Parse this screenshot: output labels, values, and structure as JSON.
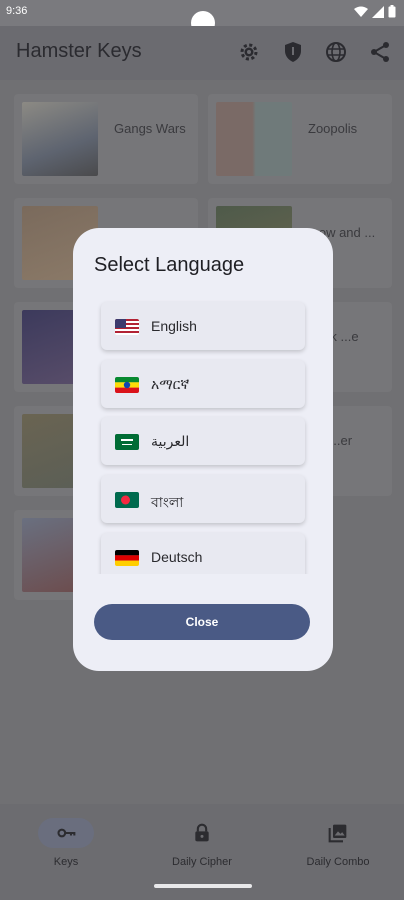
{
  "status": {
    "time": "9:36"
  },
  "app_bar": {
    "title": "Hamster Keys",
    "actions": [
      "gear-icon",
      "shield-icon",
      "globe-icon",
      "share-icon"
    ]
  },
  "games": [
    {
      "title": "Gangs Wars"
    },
    {
      "title": "Zoopolis"
    },
    {
      "title": "...ow and ..."
    },
    {
      "title": "...erk ...e"
    },
    {
      "title": "...n ...er"
    }
  ],
  "dialog": {
    "title": "Select Language",
    "languages": [
      {
        "label": "English",
        "flag": "us"
      },
      {
        "label": "አማርኛ",
        "flag": "et"
      },
      {
        "label": "العربية",
        "flag": "sa"
      },
      {
        "label": "বাংলা",
        "flag": "bd"
      },
      {
        "label": "Deutsch",
        "flag": "de"
      }
    ],
    "close_label": "Close"
  },
  "bottom_nav": [
    {
      "label": "Keys",
      "icon": "key-icon",
      "selected": true
    },
    {
      "label": "Daily Cipher",
      "icon": "lock-icon",
      "selected": false
    },
    {
      "label": "Daily Combo",
      "icon": "gallery-icon",
      "selected": false
    }
  ],
  "colors": {
    "accent": "#4a5a85",
    "dialog_bg": "#edeef6",
    "scrim": "#6e6e70"
  }
}
